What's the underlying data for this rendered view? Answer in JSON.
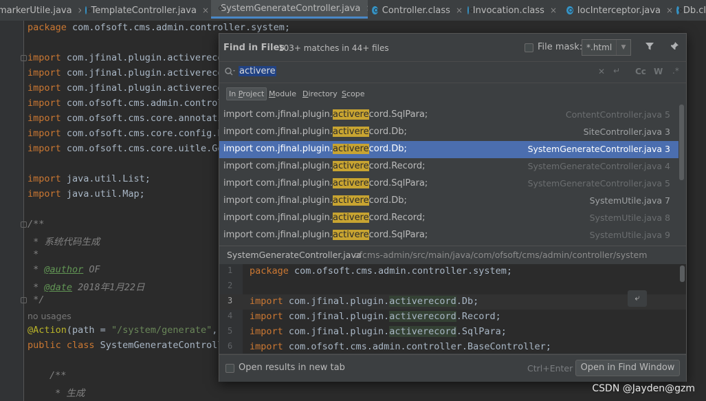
{
  "tabs": [
    {
      "label": "markerUtile.java",
      "close": "×"
    },
    {
      "label": "TemplateController.java",
      "close": "×"
    },
    {
      "label": "SystemGenerateController.java",
      "close": "×"
    },
    {
      "label": "Controller.class",
      "close": "×"
    },
    {
      "label": "Invocation.class",
      "close": "×"
    },
    {
      "label": "IocInterceptor.java",
      "close": "×"
    },
    {
      "label": "Db.cl",
      "close": ""
    }
  ],
  "editor": {
    "line_pkg_kw": "package",
    "line_pkg": " com.ofsoft.cms.admin.controller.system;",
    "imports": [
      "com.jfinal.plugin.activereco",
      "com.jfinal.plugin.activereco",
      "com.jfinal.plugin.activereco",
      "com.ofsoft.cms.admin.control",
      "com.ofsoft.cms.core.annotati",
      "com.ofsoft.cms.core.config.E",
      "com.ofsoft.cms.core.uitle.Ge"
    ],
    "imports2": [
      "java.util.List;",
      "java.util.Map;"
    ],
    "import_kw": "import",
    "comment_open": "/**",
    "comment_desc": " * 系统代码生成",
    "comment_star": " *",
    "author_tag": "@author",
    "author_val": " OF",
    "date_tag": "@date",
    "date_val": " 2018年1月22日",
    "comment_close": " */",
    "no_usages": "no usages",
    "action_ann": "@Action",
    "action_rest_a": "(path = ",
    "action_str": "\"/system/generate\"",
    "action_rest_b": ",",
    "class_kw": "public class ",
    "class_name": "SystemGenerateControll",
    "comment2_open": "/**",
    "comment2_desc": " * 生成"
  },
  "find": {
    "title": "Find in Files",
    "count": "103+ matches in 44+ files",
    "file_mask_label": "File mask:",
    "file_mask_value": "*.html",
    "query": "activere",
    "scopes": [
      {
        "label": "In Project",
        "ul": "P"
      },
      {
        "label": "Module",
        "ul": "M"
      },
      {
        "label": "Directory",
        "ul": "D"
      },
      {
        "label": "Scope",
        "ul": "S"
      }
    ],
    "results": [
      {
        "pre": "import com.jfinal.plugin.",
        "hl": "activere",
        "post": "cord.SqlPara;",
        "file": "ContentController.java 5"
      },
      {
        "pre": "import com.jfinal.plugin.",
        "hl": "activere",
        "post": "cord.Db;",
        "file": "SiteController.java 3"
      },
      {
        "pre": "import com.jfinal.plugin.",
        "hl": "activere",
        "post": "cord.Db;",
        "file": "SystemGenerateController.java 3"
      },
      {
        "pre": "import com.jfinal.plugin.",
        "hl": "activere",
        "post": "cord.Record;",
        "file": "SystemGenerateController.java 4"
      },
      {
        "pre": "import com.jfinal.plugin.",
        "hl": "activere",
        "post": "cord.SqlPara;",
        "file": "SystemGenerateController.java 5"
      },
      {
        "pre": "import com.jfinal.plugin.",
        "hl": "activere",
        "post": "cord.Db;",
        "file": "SystemUtile.java 7"
      },
      {
        "pre": "import com.jfinal.plugin.",
        "hl": "activere",
        "post": "cord.Record;",
        "file": "SystemUtile.java 8"
      },
      {
        "pre": "import com.jfinal.plugin.",
        "hl": "activere",
        "post": "cord.SqlPara;",
        "file": "SystemUtile.java 9"
      }
    ],
    "preview_file": "SystemGenerateController.java",
    "preview_path": "ofcms-admin/src/main/java/com/ofsoft/cms/admin/controller/system",
    "preview": [
      {
        "n": "1",
        "kw": "package",
        "a": " com.ofsoft.cms.admin.controller.system;",
        "g": "",
        "b": ""
      },
      {
        "n": "2",
        "kw": "",
        "a": "",
        "g": "",
        "b": ""
      },
      {
        "n": "3",
        "kw": "import",
        "a": " com.jfinal.plugin.",
        "g": "activerecord",
        "b": ".Db;"
      },
      {
        "n": "4",
        "kw": "import",
        "a": " com.jfinal.plugin.",
        "g": "activerecord",
        "b": ".Record;"
      },
      {
        "n": "5",
        "kw": "import",
        "a": " com.jfinal.plugin.",
        "g": "activerecord",
        "b": ".SqlPara;"
      },
      {
        "n": "6",
        "kw": "import",
        "a": " com.ofsoft.cms.admin.controller.BaseController;",
        "g": "",
        "b": ""
      }
    ],
    "open_new_tab": "Open results in new tab",
    "shortcut": "Ctrl+Enter",
    "open_button": "Open in Find Window"
  },
  "watermark": "CSDN @Jayden@gzm",
  "colors": {
    "accent": "#4b6eaf",
    "highlight": "#c8a431",
    "background": "#2b2b2b"
  }
}
